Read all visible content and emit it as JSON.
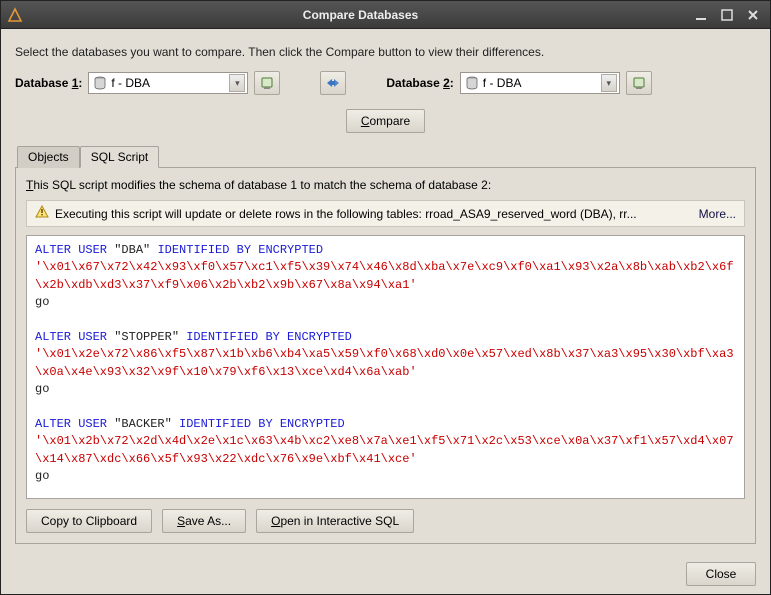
{
  "window": {
    "title": "Compare Databases"
  },
  "instruction": "Select the databases you want to compare. Then click the Compare button to view their differences.",
  "db1": {
    "label_html": "Database <span class='ul'>1</span>:",
    "value": "f - DBA"
  },
  "db2": {
    "label_html": "Database <span class='ul'>2</span>:",
    "value": "f - DBA"
  },
  "compare_btn": "<span class='ul'>C</span>ompare",
  "tabs": {
    "objects": "Objects",
    "sql": "SQL Script"
  },
  "desc": "<span class='ul'>T</span>his SQL script modifies the schema of database 1 to match the schema of database 2:",
  "warning": {
    "text": "Executing this script will update or delete rows in the following tables: rroad_ASA9_reserved_word (DBA), rr...",
    "more": "More..."
  },
  "script": {
    "stmts": [
      {
        "alter_html": "<span class='kw'>ALTER USER</span> <span class='plain'>\"DBA\"</span> <span class='kw'>IDENTIFIED BY ENCRYPTED</span>",
        "hex": "'\\x01\\x67\\x72\\x42\\x93\\xf0\\x57\\xc1\\xf5\\x39\\x74\\x46\\x8d\\xba\\x7e\\xc9\\xf0\\xa1\\x93\\x2a\\x8b\\xab\\xb2\\x6f\\x2b\\xdb\\xd3\\x37\\xf9\\x06\\x2b\\xb2\\x9b\\x67\\x8a\\x94\\xa1'",
        "go": "go"
      },
      {
        "alter_html": "<span class='kw'>ALTER USER</span> <span class='plain'>\"STOPPER\"</span> <span class='kw'>IDENTIFIED BY ENCRYPTED</span>",
        "hex": "'\\x01\\x2e\\x72\\x86\\xf5\\x87\\x1b\\xb6\\xb4\\xa5\\x59\\xf0\\x68\\xd0\\x0e\\x57\\xed\\x8b\\x37\\xa3\\x95\\x30\\xbf\\xa3\\x0a\\x4e\\x93\\x32\\x9f\\x10\\x79\\xf6\\x13\\xce\\xd4\\x6a\\xab'",
        "go": "go"
      },
      {
        "alter_html": "<span class='kw'>ALTER USER</span> <span class='plain'>\"BACKER\"</span> <span class='kw'>IDENTIFIED BY ENCRYPTED</span>",
        "hex": "'\\x01\\x2b\\x72\\x2d\\x4d\\x2e\\x1c\\x63\\x4b\\xc2\\xe8\\x7a\\xe1\\xf5\\x71\\x2c\\x53\\xce\\x0a\\x37\\xf1\\x57\\xd4\\x07\\x14\\x87\\xdc\\x66\\x5f\\x93\\x22\\xdc\\x76\\x9e\\xbf\\x41\\xce'",
        "go": "go"
      }
    ]
  },
  "buttons": {
    "copy": "Copy to Clipboard",
    "save": "<span class='ul'>S</span>ave As...",
    "open": "<span class='ul'>O</span>pen in Interactive SQL",
    "close": "Close"
  }
}
